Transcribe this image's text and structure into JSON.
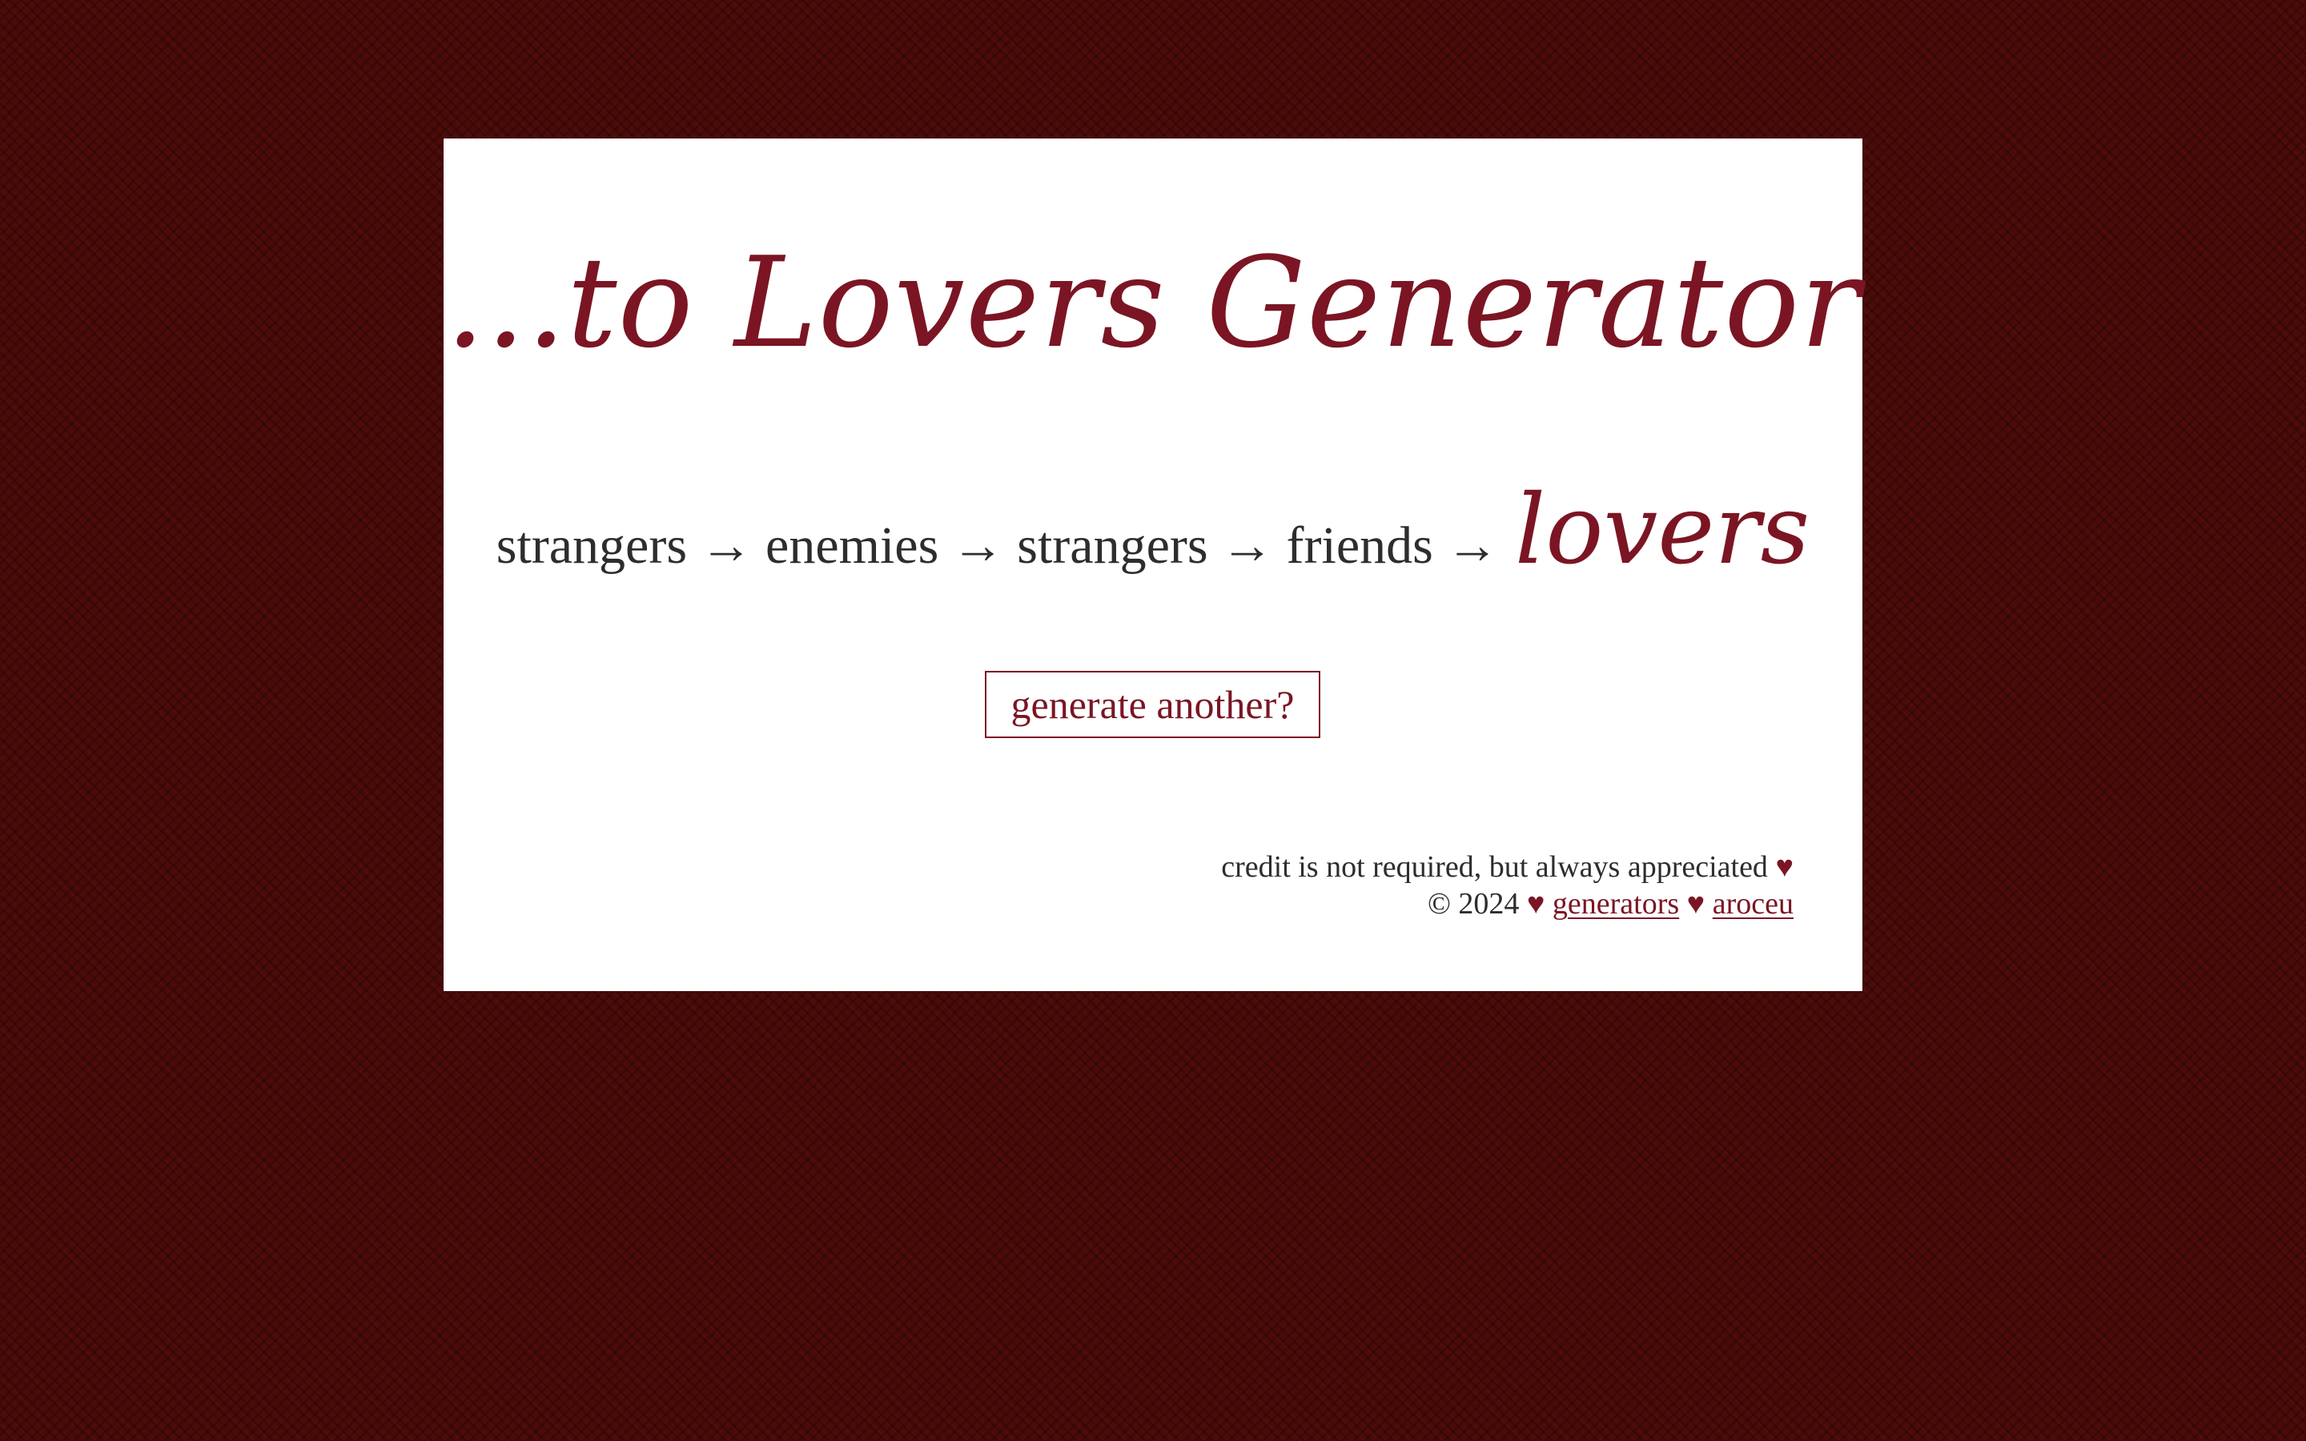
{
  "header": {
    "title": "...to Lovers Generator"
  },
  "trope": {
    "steps": [
      "strangers",
      "enemies",
      "strangers",
      "friends"
    ],
    "arrow": "→",
    "final": "lovers"
  },
  "actions": {
    "generate_label": "generate another?"
  },
  "footer": {
    "credit_text": "credit is not required, but always appreciated",
    "heart": "♥",
    "copyright": "© 2024",
    "links": [
      "generators",
      "aroceu"
    ]
  },
  "colors": {
    "background": "#4a0b09",
    "card": "#ffffff",
    "accent": "#7b1523",
    "text": "#2d2d2d"
  }
}
